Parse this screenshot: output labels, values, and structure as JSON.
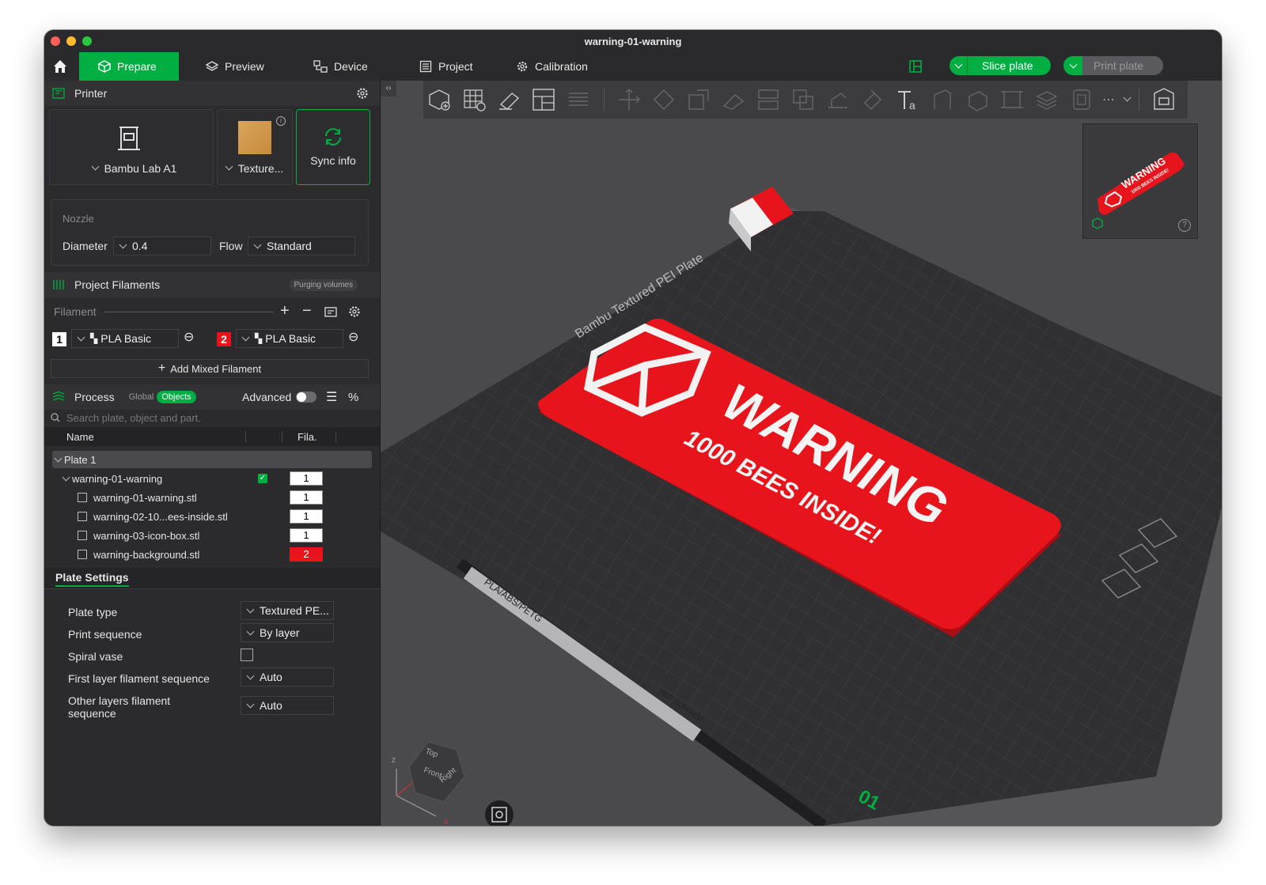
{
  "window": {
    "title": "warning-01-warning"
  },
  "tabs": [
    {
      "label": "Prepare"
    },
    {
      "label": "Preview"
    },
    {
      "label": "Device"
    },
    {
      "label": "Project"
    },
    {
      "label": "Calibration"
    }
  ],
  "actions": {
    "slice": "Slice plate",
    "print": "Print plate"
  },
  "printer": {
    "section": "Printer",
    "name": "Bambu Lab A1",
    "plate": "Texture...",
    "sync": "Sync info",
    "nozzle_title": "Nozzle",
    "diameter_label": "Diameter",
    "diameter_value": "0.4",
    "flow_label": "Flow",
    "flow_value": "Standard"
  },
  "filaments": {
    "section": "Project Filaments",
    "purging": "Purging volumes",
    "label": "Filament",
    "items": [
      {
        "index": "1",
        "name": "PLA Basic",
        "color": "#ffffff"
      },
      {
        "index": "2",
        "name": "PLA Basic",
        "color": "#e8141b"
      }
    ],
    "add_mixed": "Add Mixed Filament"
  },
  "process": {
    "section": "Process",
    "global": "Global",
    "objects": "Objects",
    "advanced": "Advanced",
    "search_placeholder": "Search plate, object and part.",
    "col_name": "Name",
    "col_fila": "Fila.",
    "plate": "Plate 1",
    "object": {
      "name": "warning-01-warning",
      "fila": "1"
    },
    "parts": [
      {
        "name": "warning-01-warning.stl",
        "fila": "1"
      },
      {
        "name": "warning-02-10...ees-inside.stl",
        "fila": "1"
      },
      {
        "name": "warning-03-icon-box.stl",
        "fila": "1"
      },
      {
        "name": "warning-background.stl",
        "fila": "2"
      }
    ]
  },
  "plate_settings": {
    "title": "Plate Settings",
    "plate_type_label": "Plate type",
    "plate_type_value": "Textured PE...",
    "print_sequence_label": "Print sequence",
    "print_sequence_value": "By layer",
    "spiral_label": "Spiral vase",
    "first_layer_label": "First layer filament sequence",
    "first_layer_value": "Auto",
    "other_layers_label": "Other layers filament sequence",
    "other_layers_value": "Auto"
  },
  "scene": {
    "sign_title": "WARNING",
    "sign_subtitle": "1000 BEES INSIDE!",
    "plate_label": "PLA/ABS/PETG",
    "hot_label": "HOT SURFACE",
    "plate_number": "01",
    "plate_text": "Bambu Textured PEI Plate",
    "cube_top": "Top",
    "cube_front": "Front",
    "cube_right": "Right",
    "axis_z": "Z",
    "axis_x": "X",
    "thumb_title": "WARNING",
    "thumb_subtitle": "1000 BEES INSIDE!"
  },
  "colors": {
    "accent": "#00ae42",
    "sign_red": "#e8141b",
    "bed": "#303033"
  }
}
